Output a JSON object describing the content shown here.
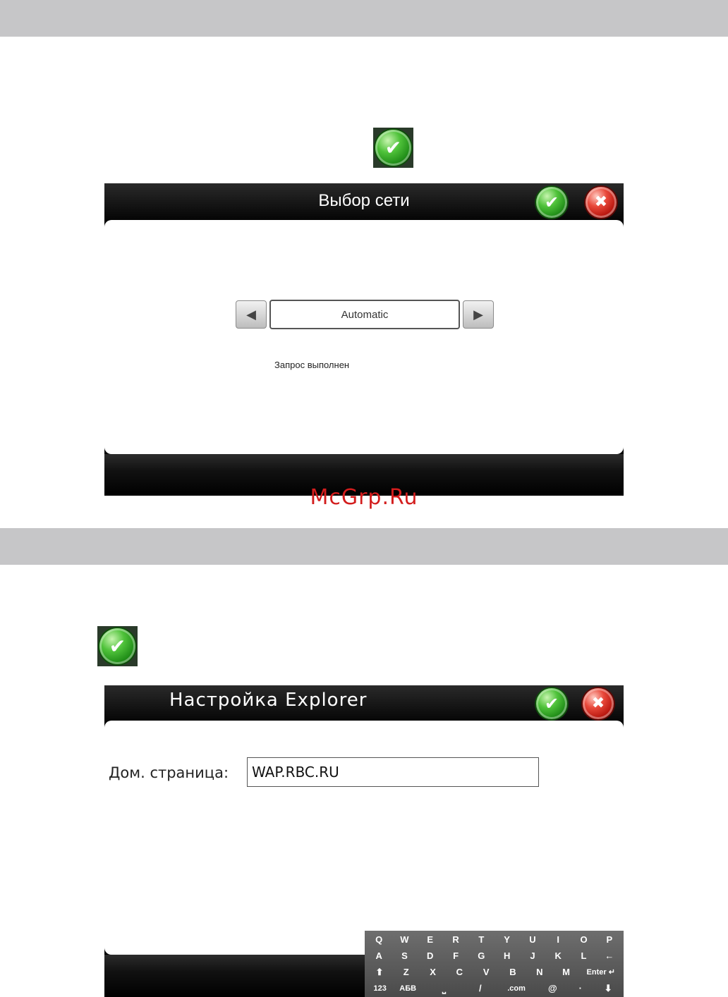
{
  "network_dialog": {
    "title": "Выбор сети",
    "selector_value": "Automatic",
    "prev_glyph": "◀",
    "next_glyph": "▶",
    "status": "Запрос выполнен",
    "ok_glyph": "✔",
    "cancel_glyph": "✖"
  },
  "explorer_dialog": {
    "title": "Настройка Explorer",
    "home_label": "Дом. страница:",
    "home_value": "WAP.RBC.RU",
    "ok_glyph": "✔",
    "cancel_glyph": "✖"
  },
  "standalone_icon_glyph": "✔",
  "watermark": "McGrp.Ru",
  "keyboard": {
    "rows": [
      [
        "Q",
        "W",
        "E",
        "R",
        "T",
        "Y",
        "U",
        "I",
        "O",
        "P"
      ],
      [
        "A",
        "S",
        "D",
        "F",
        "G",
        "H",
        "J",
        "K",
        "L",
        "←"
      ],
      [
        "⬆",
        "Z",
        "X",
        "C",
        "V",
        "B",
        "N",
        "M",
        "Enter ↵"
      ],
      [
        "123",
        "АБВ",
        "⎵",
        "/",
        ".com",
        "@",
        "·",
        "⬇"
      ]
    ]
  },
  "colors": {
    "gray_bar": "#c6c6c8",
    "ok_green": "#2ea322",
    "cancel_red": "#d3281c",
    "watermark_red": "#d31d1d"
  },
  "icons": {
    "ok": "check-circle-icon",
    "cancel": "close-circle-icon",
    "prev": "arrow-left-icon",
    "next": "arrow-right-icon"
  }
}
